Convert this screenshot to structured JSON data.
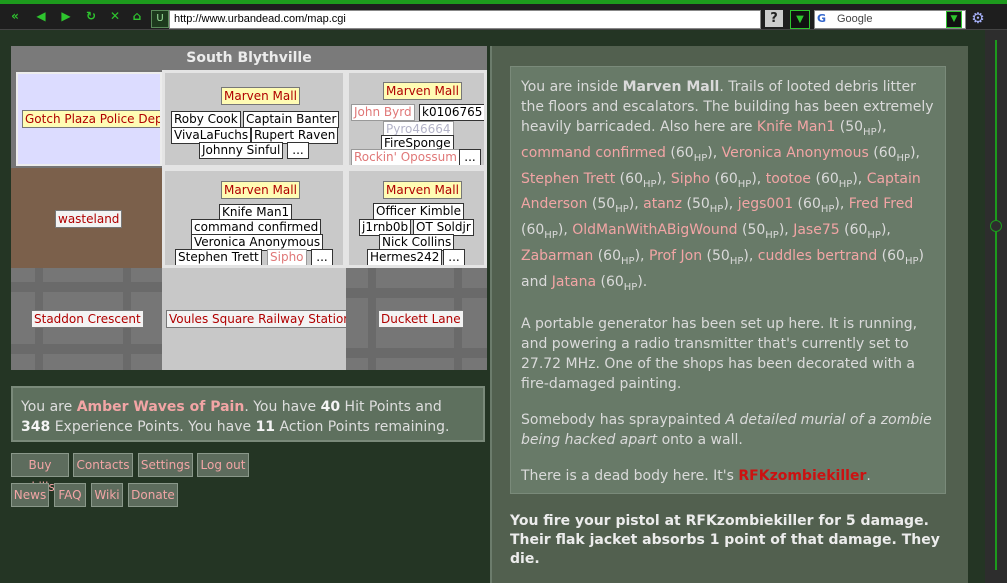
{
  "browser": {
    "url": "http://www.urbandead.com/map.cgi",
    "search_engine": "Google",
    "help_label": "?",
    "site_icon_label": "U",
    "accent_color": "#1d9a1d"
  },
  "map": {
    "suburb": "South Blythville",
    "cells": {
      "gotch": {
        "label": "Gotch Plaza Police Dept"
      },
      "mall_n": {
        "label": "Marven Mall",
        "people": [
          "Roby Cook",
          "Captain Banter",
          "VivaLaFuchs",
          "Rupert Raven",
          "Johnny Sinful"
        ],
        "more": "..."
      },
      "mall_ne": {
        "label": "Marven Mall",
        "people": [
          "John Byrd",
          "k0106765",
          "Pyro46664",
          "FireSponge",
          "Rockin' Opossum"
        ],
        "more": "..."
      },
      "wasteland": {
        "label": "wasteland"
      },
      "mall_center": {
        "label": "Marven Mall",
        "people": [
          "Knife Man1",
          "command confirmed",
          "Veronica Anonymous",
          "Stephen Trett",
          "Sipho"
        ],
        "more": "..."
      },
      "mall_e": {
        "label": "Marven Mall",
        "people": [
          "Officer Kimble",
          "j1rnb0b",
          "OT Soldjr",
          "Nick Collins",
          "Hermes242"
        ],
        "more": "..."
      },
      "staddon": {
        "label": "Staddon Crescent"
      },
      "voules": {
        "label": "Voules Square Railway Station"
      },
      "duckett": {
        "label": "Duckett Lane"
      }
    }
  },
  "status": {
    "prefix": "You are",
    "character": "Amber Waves of Pain",
    "hp_pre": ". You have",
    "hp": "40",
    "hp_post": "Hit Points and",
    "xp": "348",
    "xp_post": "Experience Points. You have",
    "ap": "11",
    "ap_post": "Action Points remaining."
  },
  "links": {
    "buy_skills": "Buy skills",
    "contacts": "Contacts",
    "settings": "Settings",
    "log_out": "Log out",
    "news": "News",
    "faq": "FAQ",
    "wiki": "Wiki",
    "donate": "Donate"
  },
  "description": {
    "intro_pre": "You are inside",
    "building": "Marven Mall",
    "intro_post": ". Trails of looted debris litter the floors and escalators. The building has been extremely heavily barricaded. Also here are",
    "hp_unit": "HP",
    "survivors": [
      {
        "name": "Knife Man1",
        "hp": "50"
      },
      {
        "name": "command confirmed",
        "hp": "60"
      },
      {
        "name": "Veronica Anonymous",
        "hp": "60"
      },
      {
        "name": "Stephen Trett",
        "hp": "60"
      },
      {
        "name": "Sipho",
        "hp": "60"
      },
      {
        "name": "tootoe",
        "hp": "60"
      },
      {
        "name": "Captain Anderson",
        "hp": "50"
      },
      {
        "name": "atanz",
        "hp": "50"
      },
      {
        "name": "jegs001",
        "hp": "60"
      },
      {
        "name": "Fred Fred",
        "hp": "60"
      },
      {
        "name": "OldManWithABigWound",
        "hp": "50"
      },
      {
        "name": "Jase75",
        "hp": "60"
      },
      {
        "name": "Zabarman",
        "hp": "60"
      },
      {
        "name": "Prof Jon",
        "hp": "50"
      },
      {
        "name": "cuddles bertrand",
        "hp": "60"
      },
      {
        "name": "Jatana",
        "hp": "60"
      }
    ],
    "and_word": "and",
    "generator": "A portable generator has been set up here. It is running, and powering a radio transmitter that's currently set to 27.72 MHz. One of the shops has been decorated with a fire-damaged painting.",
    "spray_pre": "Somebody has spraypainted",
    "spray_text": "A detailed murial of a zombie being hacked apart",
    "spray_post": "onto a wall.",
    "body_pre": "There is a dead body here. It's",
    "body_name": "RFKzombiekiller",
    "body_post": "."
  },
  "attack_message": "You fire your pistol at RFKzombiekiller for 5 damage. Their flak jacket absorbs 1 point of that damage. They die."
}
